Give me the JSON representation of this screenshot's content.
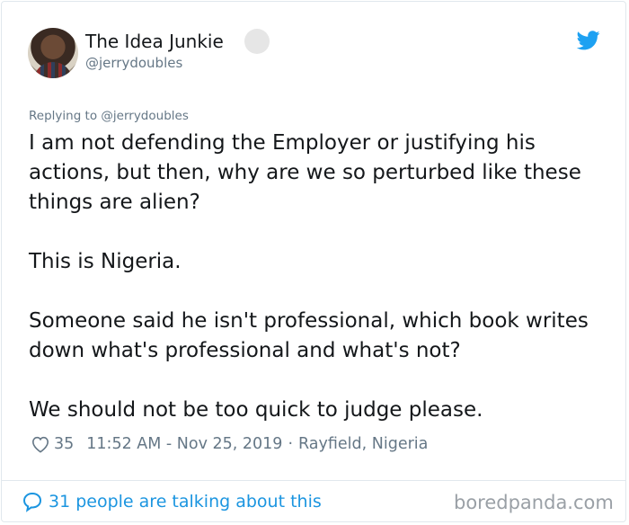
{
  "tweet": {
    "display_name": "The Idea Junkie",
    "handle": "@jerrydoubles",
    "replying_to": "Replying to @jerrydoubles",
    "paragraphs": [
      "I am not defending the Employer or justifying his actions, but then, why are we so perturbed like these things are alien?",
      "This is Nigeria.",
      "Someone said he isn't professional, which book writes down what's professional and what's not?",
      "We should not be too quick to judge please."
    ],
    "likes": "35",
    "timestamp": "11:52 AM - Nov 25, 2019",
    "separator": "·",
    "location": "Rayfield, Nigeria"
  },
  "footer": {
    "conversation_text": "31 people are talking about this"
  },
  "watermark": "boredpanda.com",
  "colors": {
    "accent": "#1b95e0",
    "muted": "#657786",
    "twitter_blue": "#1da1f2"
  },
  "icons": [
    "twitter-bird-icon",
    "heart-icon",
    "speech-bubble-icon",
    "verified-badge"
  ]
}
